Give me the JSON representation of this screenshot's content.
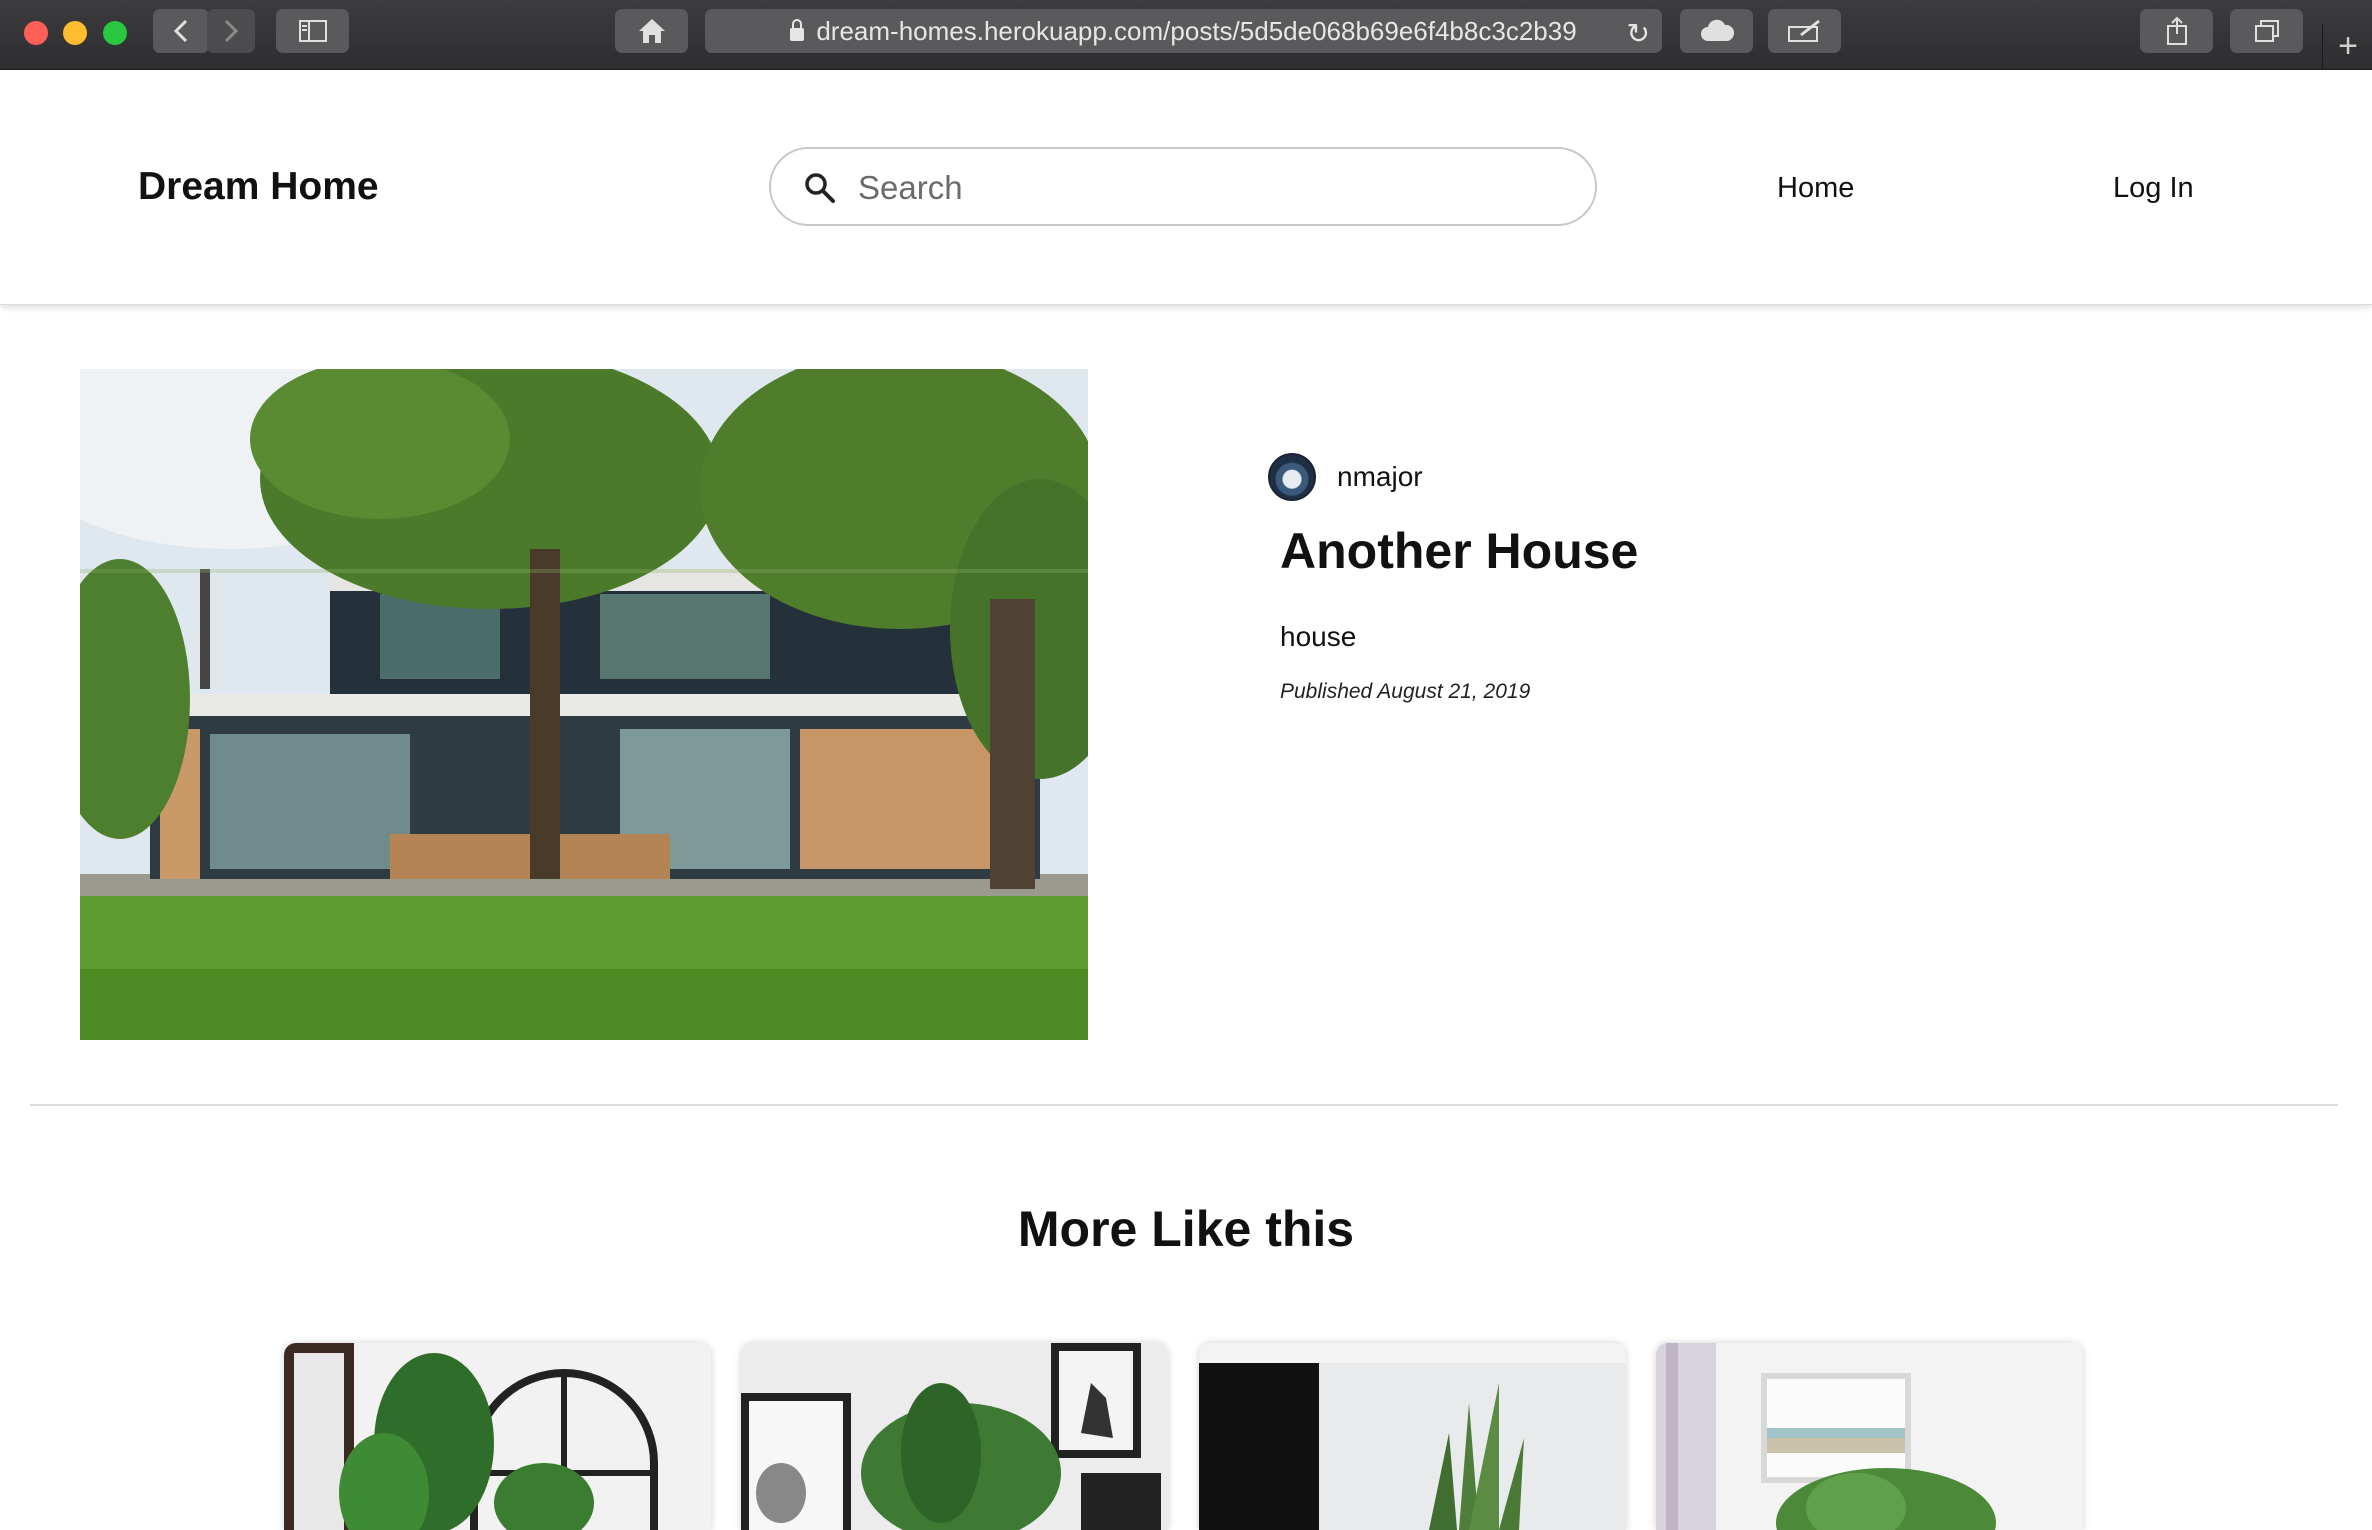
{
  "browser": {
    "url": "dream-homes.herokuapp.com/posts/5d5de068b69e6f4b8c3c2b39",
    "icons": [
      "back-icon",
      "forward-icon",
      "sidebar-icon",
      "home-icon",
      "lock-icon",
      "reload-icon",
      "cloud-icon",
      "edit-icon",
      "share-icon",
      "tabs-icon",
      "new-tab-icon"
    ]
  },
  "header": {
    "brand": "Dream Home",
    "search_placeholder": "Search",
    "nav": {
      "home": "Home",
      "login": "Log In"
    }
  },
  "post": {
    "author": "nmajor",
    "title": "Another House",
    "tag": "house",
    "published": "Published August 21, 2019"
  },
  "related": {
    "heading": "More Like this",
    "cards": [
      {
        "image": "arched-mirror-with-banana-plant"
      },
      {
        "image": "palm-with-framed-art"
      },
      {
        "image": "snake-plant-by-tv"
      },
      {
        "image": "beach-print-with-plant"
      }
    ]
  },
  "colors": {
    "chrome": "#3c3c3e",
    "accent_text": "#111111",
    "border": "#c7c7c7"
  }
}
